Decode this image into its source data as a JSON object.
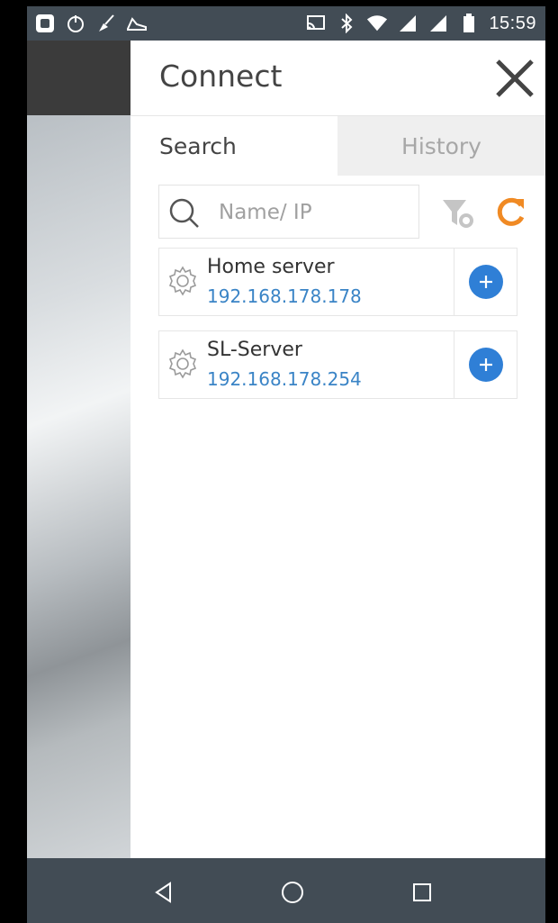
{
  "status_bar": {
    "time": "15:59",
    "left_icons": [
      "app-square-icon",
      "power-icon",
      "broom-icon",
      "sneaker-icon"
    ],
    "right_icons": [
      "cast-icon",
      "bluetooth-icon",
      "wifi-icon",
      "signal-icon",
      "signal-icon-2",
      "battery-icon"
    ]
  },
  "header": {
    "title": "Connect",
    "close_icon": "close-icon"
  },
  "tabs": [
    {
      "label": "Search",
      "active": true
    },
    {
      "label": "History",
      "active": false
    }
  ],
  "search": {
    "placeholder": "Name/ IP",
    "value": ""
  },
  "toolbar": {
    "filter_icon": "filter-icon",
    "refresh_icon": "refresh-icon",
    "refresh_color": "#f08a24"
  },
  "servers": [
    {
      "name": "Home server",
      "ip": "192.168.178.178"
    },
    {
      "name": "SL-Server",
      "ip": "192.168.178.254"
    }
  ],
  "colors": {
    "accent": "#2f7fd6",
    "ip_text": "#3a84c6",
    "status_bar": "#424c55"
  },
  "navigation": [
    "back-icon",
    "home-icon",
    "recents-icon"
  ]
}
